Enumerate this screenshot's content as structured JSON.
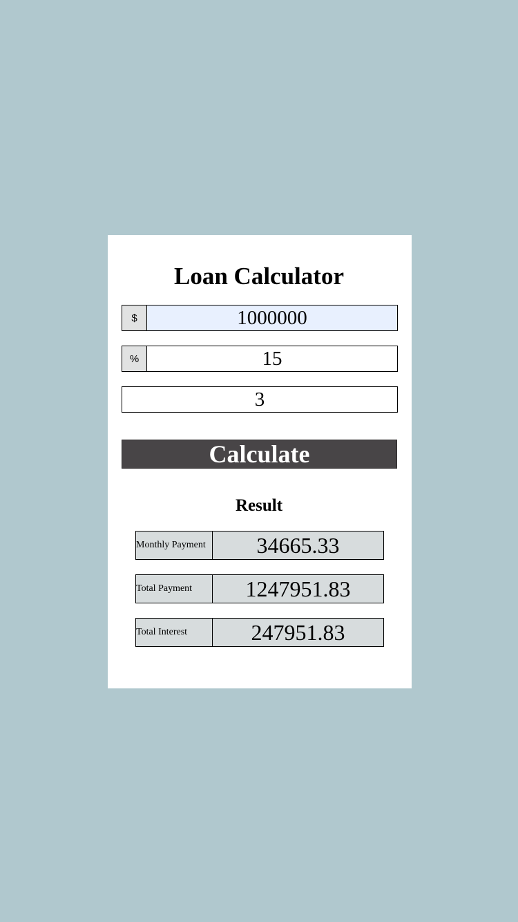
{
  "app": {
    "title": "Loan Calculator"
  },
  "colors": {
    "page_background": "#b0c8ce",
    "card_background": "#ffffff",
    "button_background": "#484547",
    "button_text": "#ffffff",
    "result_background": "#d7dcdd",
    "focused_input_background": "#e8f0fe"
  },
  "form": {
    "amount": {
      "prefix": "$",
      "value": "1000000"
    },
    "rate": {
      "prefix": "%",
      "value": "15"
    },
    "years": {
      "value": "3"
    },
    "calculate_label": "Calculate"
  },
  "result": {
    "title": "Result",
    "rows": [
      {
        "label": "Monthly Payment",
        "value": "34665.33"
      },
      {
        "label": "Total Payment",
        "value": "1247951.83"
      },
      {
        "label": "Total Interest",
        "value": "247951.83"
      }
    ]
  }
}
